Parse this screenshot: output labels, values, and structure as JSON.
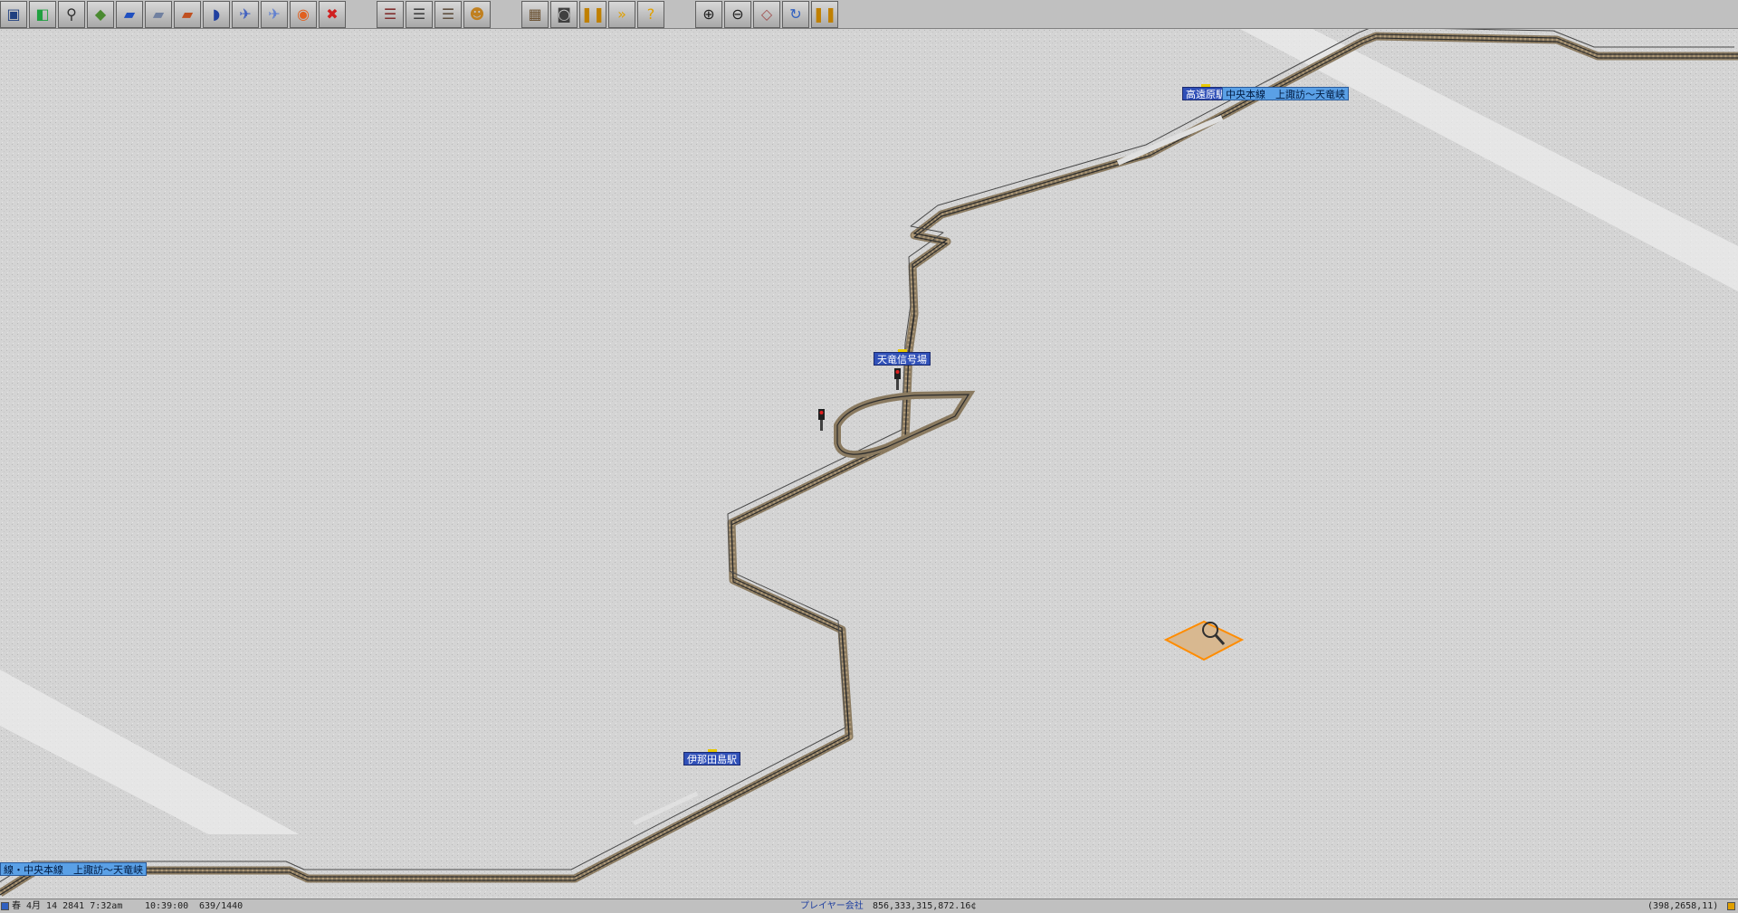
{
  "toolbar": {
    "groups": [
      [
        {
          "name": "save-icon",
          "glyph": "▣",
          "color": "#204080"
        },
        {
          "name": "new-game-icon",
          "glyph": "◧",
          "color": "#20a040"
        },
        {
          "name": "magnifier-icon",
          "glyph": "⚲",
          "color": "#303030"
        },
        {
          "name": "terrain-icon",
          "glyph": "◆",
          "color": "#4a8a30"
        },
        {
          "name": "rail-tools-icon",
          "glyph": "▰",
          "color": "#2050c0"
        },
        {
          "name": "monorail-tools-icon",
          "glyph": "▰",
          "color": "#7080a0"
        },
        {
          "name": "road-tools-icon",
          "glyph": "▰",
          "color": "#c05020"
        },
        {
          "name": "ship-tools-icon",
          "glyph": "◗",
          "color": "#2040a0"
        },
        {
          "name": "airport-tools-icon",
          "glyph": "✈",
          "color": "#4060c0"
        },
        {
          "name": "air-tools-icon",
          "glyph": "✈",
          "color": "#6080d0"
        },
        {
          "name": "special-tools-icon",
          "glyph": "◉",
          "color": "#e06020"
        },
        {
          "name": "remove-icon",
          "glyph": "✖",
          "color": "#d02020"
        }
      ],
      [
        {
          "name": "lines-icon",
          "glyph": "☰",
          "color": "#803030"
        },
        {
          "name": "list-icon",
          "glyph": "☰",
          "color": "#404040"
        },
        {
          "name": "finance-icon",
          "glyph": "☰",
          "color": "#605040"
        },
        {
          "name": "player-icon",
          "glyph": "☻",
          "color": "#c08020"
        }
      ],
      [
        {
          "name": "map-icon",
          "glyph": "▦",
          "color": "#6a5030"
        },
        {
          "name": "screenshot-icon",
          "glyph": "◙",
          "color": "#404040"
        },
        {
          "name": "pause-icon",
          "glyph": "❚❚",
          "color": "#c08000"
        },
        {
          "name": "fast-forward-icon",
          "glyph": "»",
          "color": "#e0a000"
        },
        {
          "name": "help-icon",
          "glyph": "?",
          "color": "#e0a000"
        }
      ],
      [
        {
          "name": "zoom-in-icon",
          "glyph": "⊕",
          "color": "#202020"
        },
        {
          "name": "zoom-out-icon",
          "glyph": "⊖",
          "color": "#202020"
        },
        {
          "name": "grid-icon",
          "glyph": "◇",
          "color": "#a05050"
        },
        {
          "name": "rotate-icon",
          "glyph": "↻",
          "color": "#3060c0"
        },
        {
          "name": "pause-game-icon",
          "glyph": "❚❚",
          "color": "#c08000"
        }
      ]
    ]
  },
  "map": {
    "labels": {
      "station_top": "高遠原駅",
      "line_top": "中央本線　上諏訪～天竜峡",
      "signal_station": "天竜信号場",
      "station_bottom": "伊那田島駅",
      "line_bottom": "線・中央本線　上諏訪～天竜峡"
    }
  },
  "statusbar": {
    "date": "春 4月 14 2841  7:32am",
    "time": "10:39:00",
    "speed": "639/1440",
    "company": "プレイヤー会社",
    "money": "856,333,315,872.16¢",
    "coords": "(398,2658,11)"
  },
  "colors": {
    "snow": "#d6d6d6",
    "track_bed": "#8a7a60",
    "rail": "#303030",
    "station_label": "#3050b8",
    "line_label": "#5aa0e6",
    "cursor": "#ff8c00"
  }
}
